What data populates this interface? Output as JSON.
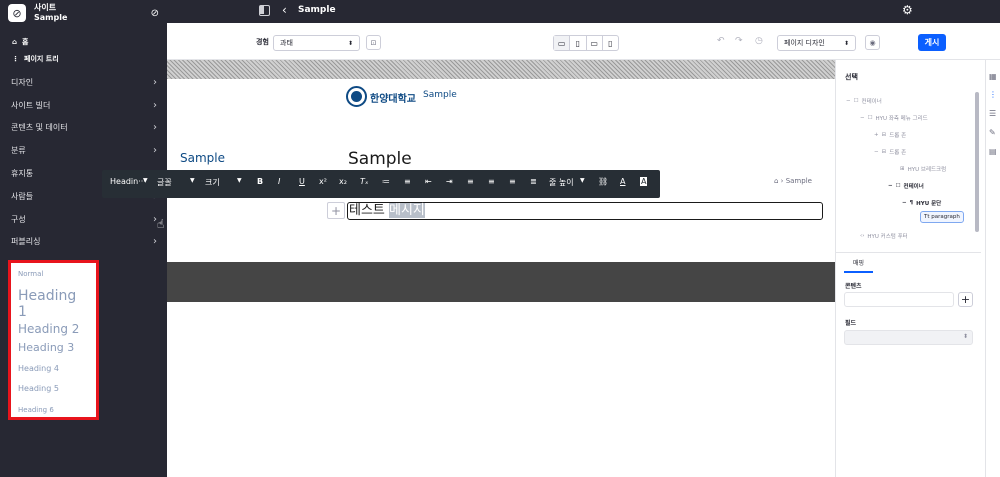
{
  "sidebar": {
    "site_label": "사이트",
    "site_name": "Sample",
    "nav": {
      "home": "홈",
      "page_tree": "페이지 트리"
    },
    "menu": [
      {
        "label": "디자인"
      },
      {
        "label": "사이트 빌더"
      },
      {
        "label": "콘텐츠 및 데이터"
      },
      {
        "label": "분류"
      },
      {
        "label": "휴지통"
      },
      {
        "label": "사람들"
      },
      {
        "label": "구성"
      },
      {
        "label": "퍼블리싱"
      }
    ]
  },
  "heading_dropdown": {
    "items": [
      "Normal",
      "Heading 1",
      "Heading 2",
      "Heading 3",
      "Heading 4",
      "Heading 5",
      "Heading 6"
    ]
  },
  "topbar": {
    "title": "Sample"
  },
  "toolbar": {
    "experience_label": "경험",
    "experience_value": "과태",
    "view_mode": "페이지 디자인",
    "publish_label": "게시"
  },
  "canvas": {
    "logo_text": "한양대학교",
    "logo_sample": "Sample",
    "side_title": "Sample",
    "page_title": "Sample",
    "breadcrumb": "⌂  ›  Sample",
    "edit_text_plain": "테스트 ",
    "edit_text_selected": "메시지"
  },
  "rte": {
    "heading": "Headin···",
    "font": "글꼴",
    "size": "크기",
    "line_height": "줄 높이"
  },
  "right_panel": {
    "title": "선택",
    "tree": [
      {
        "label": "컨테이너"
      },
      {
        "label": "HYU 좌측 메뉴 그리드"
      },
      {
        "label": "드롭 존"
      },
      {
        "label": "드롭 존"
      },
      {
        "label": "HYU 브레드크럼"
      },
      {
        "label": "컨테이너"
      },
      {
        "label": "HYU 문단"
      },
      {
        "label": "paragraph"
      },
      {
        "label": "HYU 커스텀 푸터"
      }
    ],
    "tab": "매핑",
    "content_label": "콘텐츠",
    "field_label": "필드"
  }
}
